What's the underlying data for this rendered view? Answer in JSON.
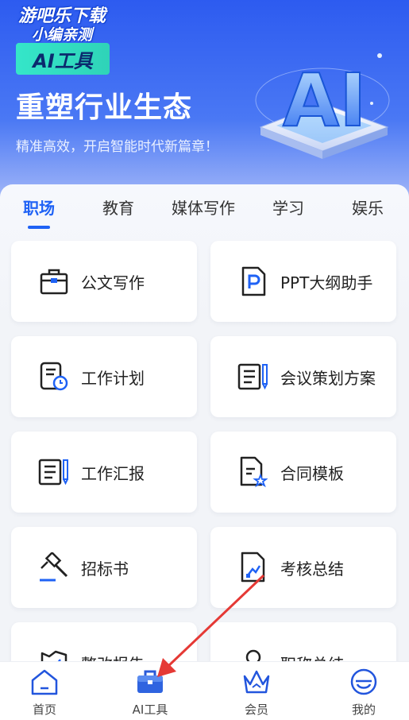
{
  "watermark": {
    "line1": "游吧乐下载",
    "line2": "小编亲测"
  },
  "hero": {
    "badge": "AI工具",
    "title": "重塑行业生态",
    "subtitle": "精准高效，开启智能时代新篇章！",
    "art_text": "AI"
  },
  "tabs": [
    {
      "label": "职场",
      "active": true
    },
    {
      "label": "教育",
      "active": false
    },
    {
      "label": "媒体写作",
      "active": false
    },
    {
      "label": "学习",
      "active": false
    },
    {
      "label": "娱乐",
      "active": false
    }
  ],
  "cards": [
    {
      "label": "公文写作",
      "icon": "briefcase-icon"
    },
    {
      "label": "PPT大纲助手",
      "icon": "ppt-file-icon"
    },
    {
      "label": "工作计划",
      "icon": "schedule-doc-icon"
    },
    {
      "label": "会议策划方案",
      "icon": "notes-pen-icon"
    },
    {
      "label": "工作汇报",
      "icon": "notes-pen-icon"
    },
    {
      "label": "合同模板",
      "icon": "contract-star-icon"
    },
    {
      "label": "招标书",
      "icon": "gavel-icon"
    },
    {
      "label": "考核总结",
      "icon": "chart-doc-icon"
    },
    {
      "label": "整改报告",
      "icon": "report-icon"
    },
    {
      "label": "职称总结",
      "icon": "person-icon"
    }
  ],
  "bottom_nav": [
    {
      "label": "首页",
      "icon": "home-icon"
    },
    {
      "label": "AI工具",
      "icon": "toolbox-icon",
      "active": true
    },
    {
      "label": "会员",
      "icon": "crown-icon"
    },
    {
      "label": "我的",
      "icon": "profile-icon"
    }
  ],
  "colors": {
    "accent": "#1f62f5",
    "icon_dark": "#222222",
    "icon_blue": "#1f62f5",
    "badge_bg": "#2fd3b8",
    "annotation_arrow": "#e53935"
  }
}
